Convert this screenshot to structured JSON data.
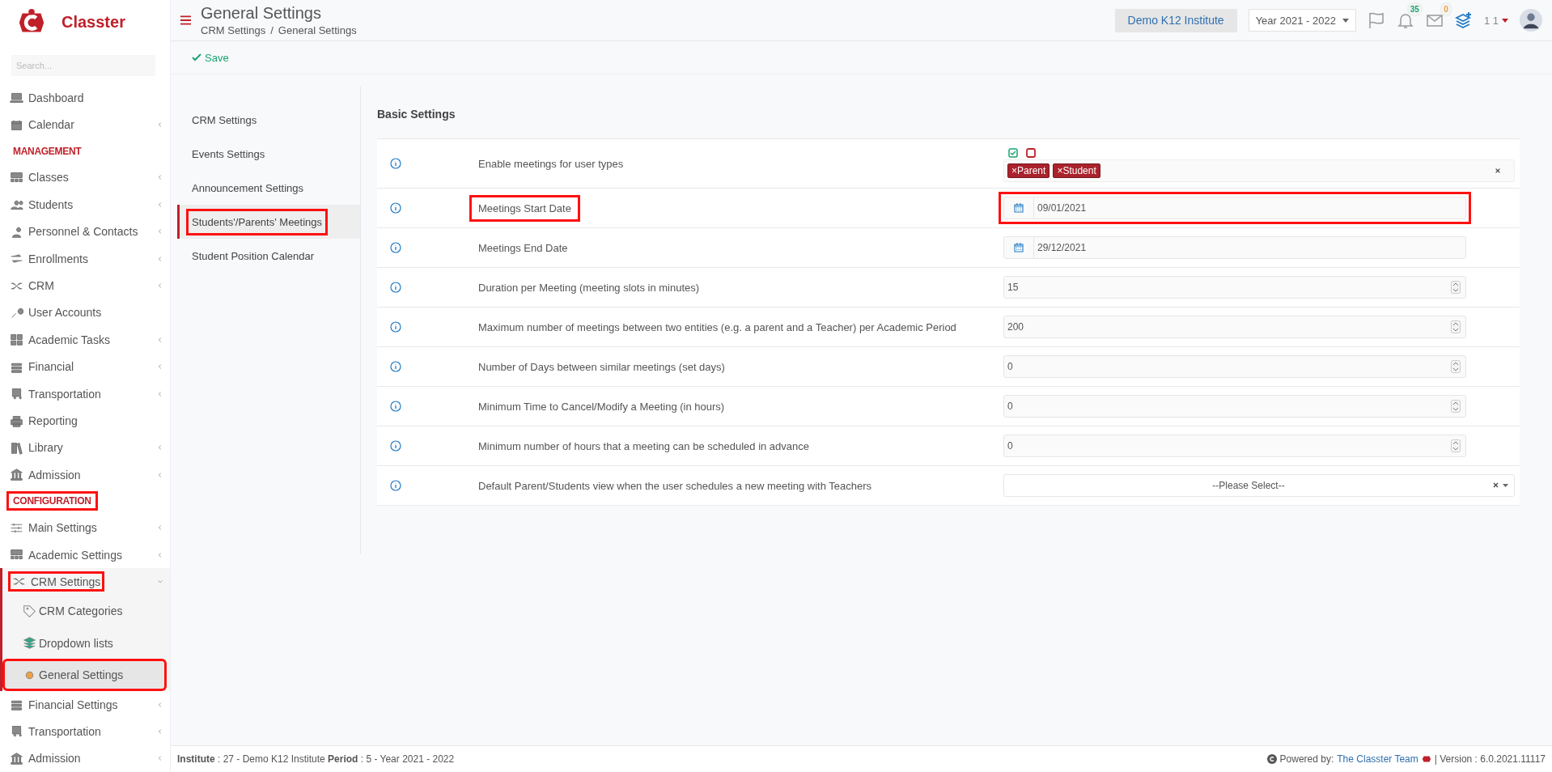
{
  "brand": {
    "name": "Classter"
  },
  "sidebar": {
    "search_placeholder": "Search...",
    "items": [
      {
        "kind": "item",
        "label": "Dashboard",
        "has_submenu": false,
        "expanded": false,
        "selected": false,
        "highlighted": false
      },
      {
        "kind": "item",
        "label": "Calendar",
        "has_submenu": true,
        "expanded": false,
        "selected": false,
        "highlighted": false
      },
      {
        "kind": "heading",
        "label": "MANAGEMENT",
        "highlighted": false
      },
      {
        "kind": "item",
        "label": "Classes",
        "has_submenu": true,
        "expanded": false,
        "selected": false,
        "highlighted": false
      },
      {
        "kind": "item",
        "label": "Students",
        "has_submenu": true,
        "expanded": false,
        "selected": false,
        "highlighted": false
      },
      {
        "kind": "item",
        "label": "Personnel & Contacts",
        "has_submenu": true,
        "expanded": false,
        "selected": false,
        "highlighted": false
      },
      {
        "kind": "item",
        "label": "Enrollments",
        "has_submenu": true,
        "expanded": false,
        "selected": false,
        "highlighted": false
      },
      {
        "kind": "item",
        "label": "CRM",
        "has_submenu": true,
        "expanded": false,
        "selected": false,
        "highlighted": false
      },
      {
        "kind": "item",
        "label": "User Accounts",
        "has_submenu": false,
        "expanded": false,
        "selected": false,
        "highlighted": false
      },
      {
        "kind": "item",
        "label": "Academic Tasks",
        "has_submenu": true,
        "expanded": false,
        "selected": false,
        "highlighted": false
      },
      {
        "kind": "item",
        "label": "Financial",
        "has_submenu": true,
        "expanded": false,
        "selected": false,
        "highlighted": false
      },
      {
        "kind": "item",
        "label": "Transportation",
        "has_submenu": true,
        "expanded": false,
        "selected": false,
        "highlighted": false
      },
      {
        "kind": "item",
        "label": "Reporting",
        "has_submenu": false,
        "expanded": false,
        "selected": false,
        "highlighted": false
      },
      {
        "kind": "item",
        "label": "Library",
        "has_submenu": true,
        "expanded": false,
        "selected": false,
        "highlighted": false
      },
      {
        "kind": "item",
        "label": "Admission",
        "has_submenu": true,
        "expanded": false,
        "selected": false,
        "highlighted": false
      },
      {
        "kind": "heading",
        "label": "CONFIGURATION",
        "highlighted": true
      },
      {
        "kind": "item",
        "label": "Main Settings",
        "has_submenu": true,
        "expanded": false,
        "selected": false,
        "highlighted": false
      },
      {
        "kind": "item",
        "label": "Academic Settings",
        "has_submenu": true,
        "expanded": false,
        "selected": false,
        "highlighted": false
      },
      {
        "kind": "item",
        "label": "CRM Settings",
        "has_submenu": true,
        "expanded": true,
        "selected": false,
        "highlighted": true,
        "children": [
          {
            "label": "CRM Categories",
            "selected": false,
            "highlighted": false
          },
          {
            "label": "Dropdown lists",
            "selected": false,
            "highlighted": false
          },
          {
            "label": "General Settings",
            "selected": true,
            "highlighted": true
          }
        ]
      },
      {
        "kind": "item",
        "label": "Financial Settings",
        "has_submenu": true,
        "expanded": false,
        "selected": false,
        "highlighted": false
      },
      {
        "kind": "item",
        "label": "Transportation",
        "has_submenu": true,
        "expanded": false,
        "selected": false,
        "highlighted": false
      },
      {
        "kind": "item",
        "label": "Admission",
        "has_submenu": true,
        "expanded": false,
        "selected": false,
        "highlighted": false
      }
    ]
  },
  "header": {
    "title": "General Settings",
    "breadcrumb": [
      "CRM Settings",
      "General Settings"
    ],
    "breadcrumb_separator": "/",
    "institute": "Demo K12 Institute",
    "year": "Year 2021 - 2022",
    "notifications": "35",
    "messages": "0",
    "user": "1 1"
  },
  "toolbar": {
    "save": "Save"
  },
  "settings_menu": [
    {
      "label": "CRM Settings",
      "selected": false,
      "highlighted": false
    },
    {
      "label": "Events Settings",
      "selected": false,
      "highlighted": false
    },
    {
      "label": "Announcement Settings",
      "selected": false,
      "highlighted": false
    },
    {
      "label": "Students'/Parents' Meetings",
      "selected": true,
      "highlighted": true
    },
    {
      "label": "Student Position Calendar",
      "selected": false,
      "highlighted": false
    }
  ],
  "panel": {
    "title": "Basic Settings",
    "rows": [
      {
        "kind": "tags",
        "label": "Enable meetings for user types",
        "tags": [
          "×Parent",
          "×Student"
        ],
        "label_highlighted": false,
        "field_highlighted": false
      },
      {
        "kind": "date",
        "label": "Meetings Start Date",
        "value": "09/01/2021",
        "label_highlighted": true,
        "field_highlighted": true
      },
      {
        "kind": "date",
        "label": "Meetings End Date",
        "value": "29/12/2021",
        "label_highlighted": false,
        "field_highlighted": false
      },
      {
        "kind": "number",
        "label": "Duration per Meeting (meeting slots in minutes)",
        "value": "15",
        "label_highlighted": false,
        "field_highlighted": false
      },
      {
        "kind": "number",
        "label": "Maximum number of meetings between two entities (e.g. a parent and a Teacher) per Academic Period",
        "value": "200",
        "label_highlighted": false,
        "field_highlighted": false
      },
      {
        "kind": "number",
        "label": "Number of Days between similar meetings (set days)",
        "value": "0",
        "label_highlighted": false,
        "field_highlighted": false
      },
      {
        "kind": "number",
        "label": "Minimum Time to Cancel/Modify a Meeting (in hours)",
        "value": "0",
        "label_highlighted": false,
        "field_highlighted": false
      },
      {
        "kind": "number",
        "label": "Minimum number of hours that a meeting can be scheduled in advance",
        "value": "0",
        "label_highlighted": false,
        "field_highlighted": false
      },
      {
        "kind": "select",
        "label": "Default Parent/Students view when the user schedules a new meeting with Teachers",
        "value": "--Please Select--",
        "label_highlighted": false,
        "field_highlighted": false
      }
    ]
  },
  "footer": {
    "info": "**Institute** : 27 - Demo K12 Institute **Period** : 5 - Year 2021 - 2022",
    "powered": "Powered by:",
    "team": "The Classter Team",
    "version": "| Version : 6.0.2021.11117"
  }
}
